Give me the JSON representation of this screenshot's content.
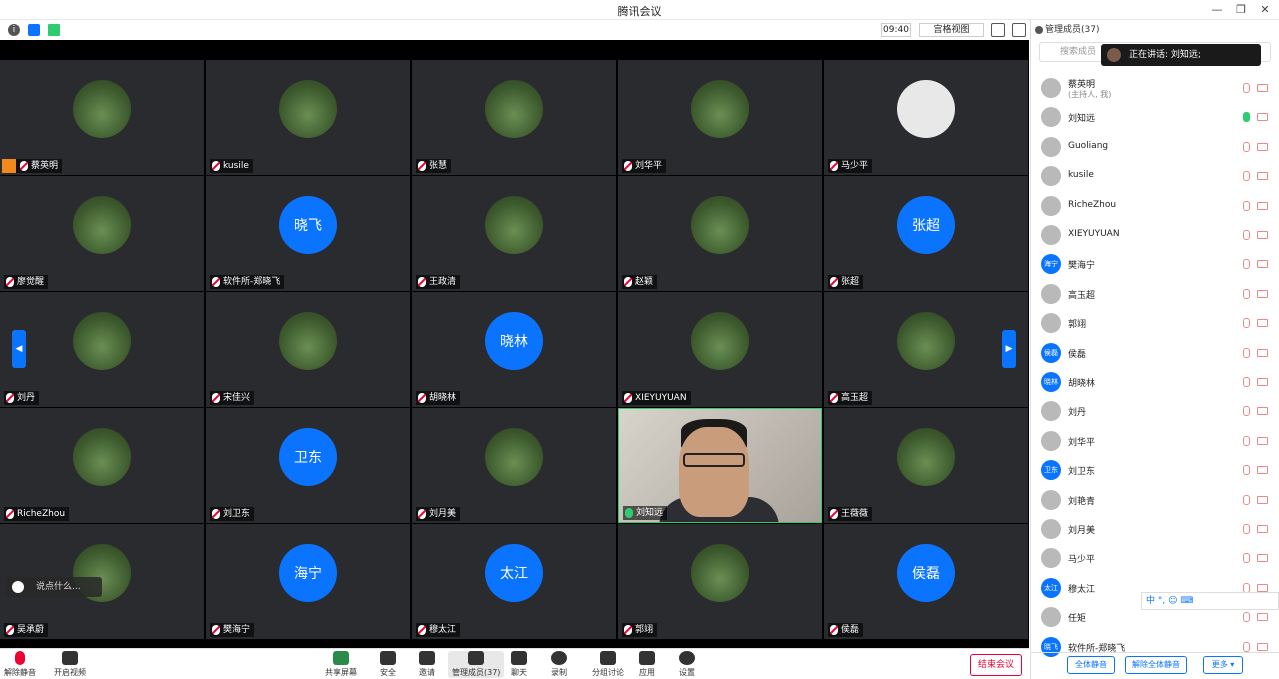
{
  "window": {
    "title": "腾讯会议",
    "time": "09:40",
    "view_mode": "宫格视图"
  },
  "panel": {
    "header": "管理成员(37)",
    "search_placeholder": "搜索成员",
    "speaking": "正在讲话: 刘知远;",
    "members": [
      {
        "name": "蔡英明",
        "sub": "(主持人, 我)",
        "avatar": "",
        "mic_on": false
      },
      {
        "name": "刘知远",
        "sub": "",
        "avatar": "",
        "mic_on": true
      },
      {
        "name": "Guoliang",
        "sub": "",
        "avatar": "",
        "mic_on": false
      },
      {
        "name": "kusile",
        "sub": "",
        "avatar": "",
        "mic_on": false
      },
      {
        "name": "RicheZhou",
        "sub": "",
        "avatar": "",
        "mic_on": false
      },
      {
        "name": "XIEYUYUAN",
        "sub": "",
        "avatar": "",
        "mic_on": false
      },
      {
        "name": "樊海宁",
        "sub": "",
        "avatar": "海宁",
        "mic_on": false
      },
      {
        "name": "高玉超",
        "sub": "",
        "avatar": "",
        "mic_on": false
      },
      {
        "name": "郭翊",
        "sub": "",
        "avatar": "",
        "mic_on": false
      },
      {
        "name": "侯磊",
        "sub": "",
        "avatar": "侯磊",
        "mic_on": false
      },
      {
        "name": "胡晓林",
        "sub": "",
        "avatar": "晓林",
        "mic_on": false
      },
      {
        "name": "刘丹",
        "sub": "",
        "avatar": "",
        "mic_on": false
      },
      {
        "name": "刘华平",
        "sub": "",
        "avatar": "",
        "mic_on": false
      },
      {
        "name": "刘卫东",
        "sub": "",
        "avatar": "卫东",
        "mic_on": false
      },
      {
        "name": "刘艳青",
        "sub": "",
        "avatar": "",
        "mic_on": false
      },
      {
        "name": "刘月美",
        "sub": "",
        "avatar": "",
        "mic_on": false
      },
      {
        "name": "马少平",
        "sub": "",
        "avatar": "",
        "mic_on": false
      },
      {
        "name": "穆太江",
        "sub": "",
        "avatar": "太江",
        "mic_on": false
      },
      {
        "name": "任矩",
        "sub": "",
        "avatar": "",
        "mic_on": false
      },
      {
        "name": "软件所-郑晓飞",
        "sub": "",
        "avatar": "晓飞",
        "mic_on": false
      }
    ],
    "btn_mute_all": "全体静音",
    "btn_unmute_all": "解除全体静音",
    "btn_more": "更多 ▾"
  },
  "tiles": [
    {
      "name": "蔡英明",
      "avatar": "",
      "blue": false,
      "host": true
    },
    {
      "name": "kusile",
      "avatar": "",
      "blue": false
    },
    {
      "name": "张慧",
      "avatar": "",
      "blue": false
    },
    {
      "name": "刘华平",
      "avatar": "",
      "blue": false
    },
    {
      "name": "马少平",
      "avatar": "",
      "blue": false,
      "gray": true
    },
    {
      "name": "廖觉醒",
      "avatar": "",
      "blue": false
    },
    {
      "name": "软件所-郑晓飞",
      "avatar": "晓飞",
      "blue": true
    },
    {
      "name": "王政清",
      "avatar": "",
      "blue": false
    },
    {
      "name": "赵颖",
      "avatar": "",
      "blue": false
    },
    {
      "name": "张超",
      "avatar": "张超",
      "blue": true
    },
    {
      "name": "刘丹",
      "avatar": "",
      "blue": false
    },
    {
      "name": "宋佳兴",
      "avatar": "",
      "blue": false
    },
    {
      "name": "胡晓林",
      "avatar": "晓林",
      "blue": true
    },
    {
      "name": "XIEYUYUAN",
      "avatar": "",
      "blue": false
    },
    {
      "name": "高玉超",
      "avatar": "",
      "blue": false
    },
    {
      "name": "RicheZhou",
      "avatar": "",
      "blue": false
    },
    {
      "name": "刘卫东",
      "avatar": "卫东",
      "blue": true
    },
    {
      "name": "刘月美",
      "avatar": "",
      "blue": false
    },
    {
      "name": "刘知远",
      "avatar": "",
      "blue": false,
      "video": true
    },
    {
      "name": "王薇薇",
      "avatar": "",
      "blue": false
    },
    {
      "name": "吴承蔚",
      "avatar": "",
      "blue": false
    },
    {
      "name": "樊海宁",
      "avatar": "海宁",
      "blue": true
    },
    {
      "name": "穆太江",
      "avatar": "太江",
      "blue": true
    },
    {
      "name": "郭翊",
      "avatar": "",
      "blue": false
    },
    {
      "name": "侯磊",
      "avatar": "侯磊",
      "blue": true
    }
  ],
  "chat_hint": "说点什么...",
  "toolbar": {
    "unmute": "解除静音",
    "start_video": "开启视频",
    "share": "共享屏幕",
    "security": "安全",
    "invite": "邀请",
    "members": "管理成员(37)",
    "chat": "聊天",
    "record": "录制",
    "breakout": "分组讨论",
    "apps": "应用",
    "settings": "设置",
    "end": "结束会议"
  },
  "ime": "中 °, ☺ ⌨"
}
